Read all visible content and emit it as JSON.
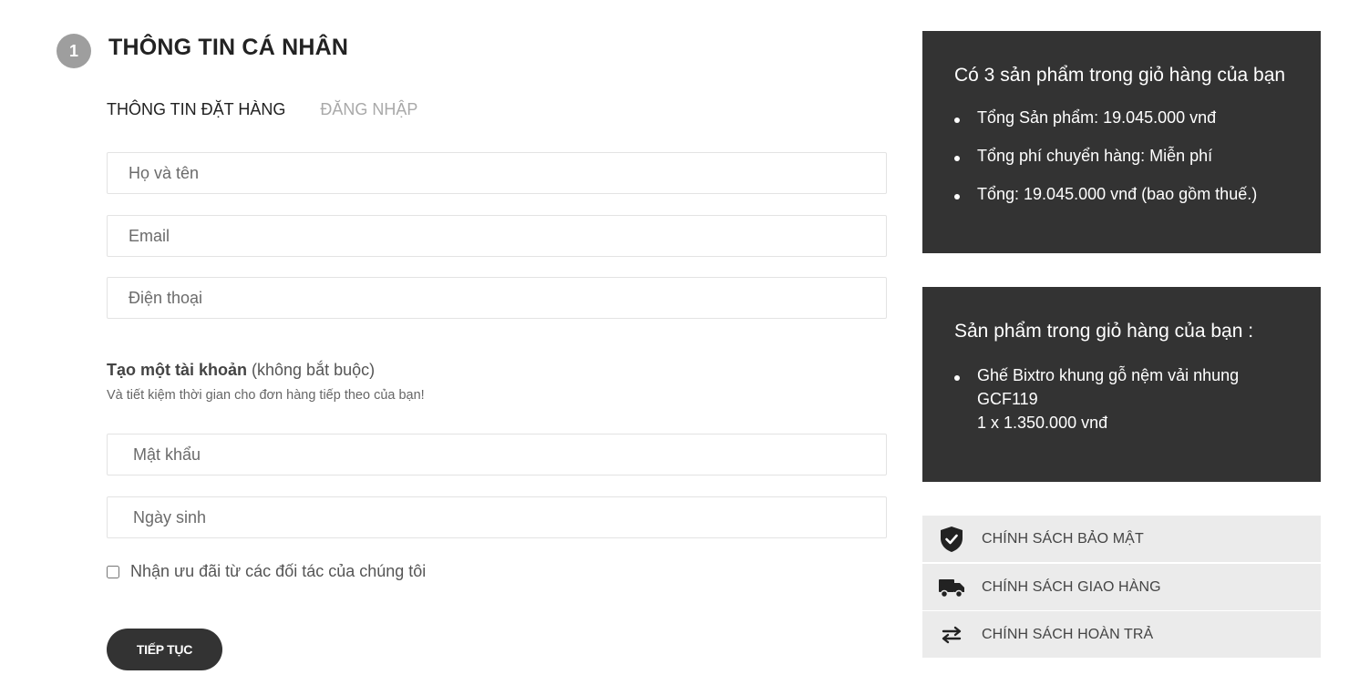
{
  "step": {
    "number": "1",
    "title": "THÔNG TIN CÁ NHÂN"
  },
  "tabs": [
    {
      "label": "THÔNG TIN ĐẶT HÀNG",
      "active": true
    },
    {
      "label": "ĐĂNG NHẬP",
      "active": false
    }
  ],
  "form": {
    "fullname_placeholder": "Họ và tên",
    "email_placeholder": "Email",
    "phone_placeholder": "Điện thoại",
    "create_account_bold": "Tạo một tài khoản",
    "create_account_note": " (không bắt buộc)",
    "create_account_sub": "Và tiết kiệm thời gian cho đơn hàng tiếp theo của bạn!",
    "password_placeholder": "Mật khẩu",
    "birthday_placeholder": "Ngày sinh",
    "partner_offers_label": "Nhận ưu đãi từ các đối tác của chúng tôi",
    "partner_offers_checked": false,
    "continue_label": "TIẾP TỤC"
  },
  "cart_summary": {
    "heading": "Có 3 sản phẩm trong giỏ hàng của bạn",
    "items": [
      "Tổng Sản phẩm: 19.045.000 vnđ",
      "Tổng phí chuyển hàng: Miễn phí",
      "Tổng: 19.045.000 vnđ (bao gồm thuế.)"
    ]
  },
  "cart_items": {
    "heading": "Sản phẩm trong giỏ hàng của bạn :",
    "item_name_line1": "Ghế Bixtro khung gỗ nệm vải nhung",
    "item_name_line2": "GCF119",
    "item_qty_price": "1 x 1.350.000 vnđ"
  },
  "policies": [
    {
      "label": "CHÍNH SÁCH BẢO MẬT",
      "icon": "shield-check-icon"
    },
    {
      "label": "CHÍNH SÁCH GIAO HÀNG",
      "icon": "truck-icon"
    },
    {
      "label": "CHÍNH SÁCH HOÀN TRẢ",
      "icon": "swap-arrows-icon"
    }
  ],
  "colors": {
    "panel_bg": "#333333",
    "policy_bg": "#ebebeb",
    "step_badge": "#9e9e9e",
    "button_bg": "#333333"
  }
}
